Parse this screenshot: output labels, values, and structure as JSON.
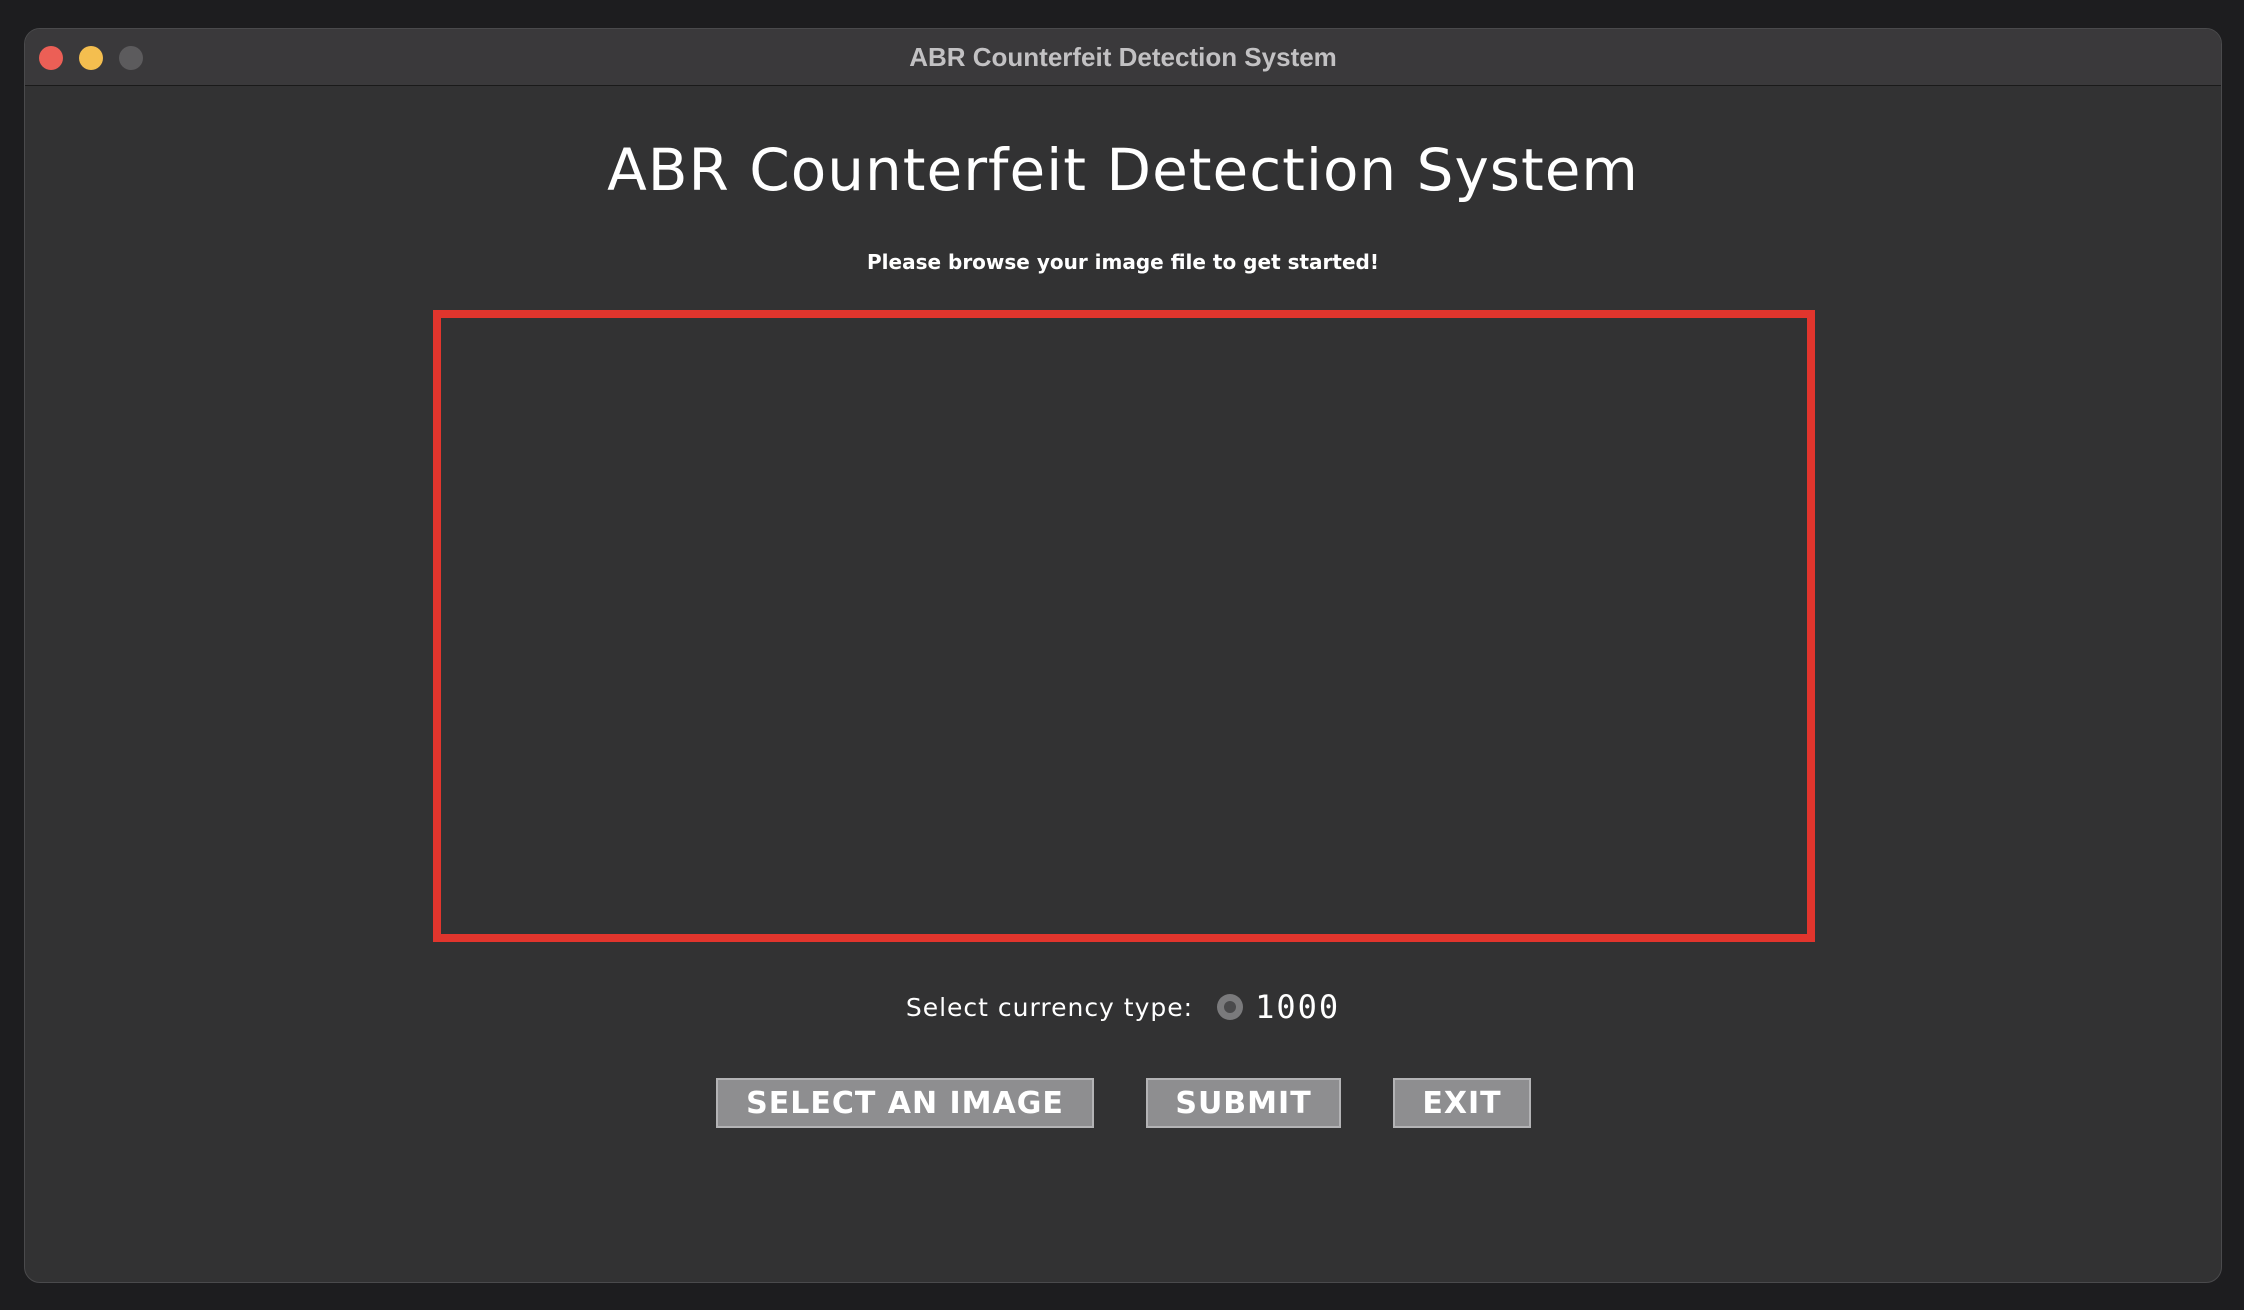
{
  "window": {
    "title": "ABR Counterfeit Detection System"
  },
  "main": {
    "heading": "ABR Counterfeit Detection System",
    "subheading": "Please browse your image file to get started!",
    "currency": {
      "label": "Select currency type:",
      "options": [
        "1000"
      ],
      "selected": "1000"
    },
    "buttons": {
      "select_image": "SELECT AN IMAGE",
      "submit": "SUBMIT",
      "exit": "EXIT"
    }
  },
  "colors": {
    "background": "#323233",
    "frame_border": "#e1352d",
    "button_bg": "#8e8e90",
    "text": "#ffffff"
  }
}
